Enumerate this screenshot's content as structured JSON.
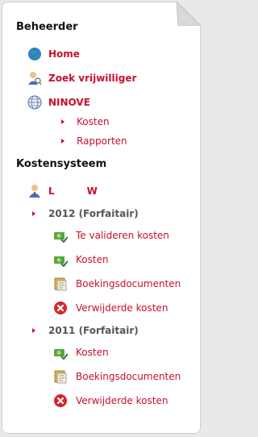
{
  "sections": {
    "beheerder": {
      "title": "Beheerder",
      "home": "Home",
      "zoek": "Zoek vrijwilliger",
      "ninove": "NINOVE",
      "kosten": "Kosten",
      "rapporten": "Rapporten"
    },
    "kostensysteem": {
      "title": "Kostensysteem",
      "user_initial": "L",
      "user_second": "W",
      "year_2012": "2012 (Forfaitair)",
      "items_2012": [
        "Te valideren kosten",
        "Kosten",
        "Boekingsdocumenten",
        "Verwijderde kosten"
      ],
      "year_2011": "2011 (Forfaitair)",
      "items_2011": [
        "Kosten",
        "Boekingsdocumenten",
        "Verwijderde kosten"
      ]
    }
  },
  "colors": {
    "link": "#c8102e",
    "heading": "#111111",
    "year": "#555555"
  },
  "icons": [
    "globe-icon",
    "user-search-icon",
    "web-globe-icon",
    "user-icon",
    "money-check-icon",
    "document-icon",
    "delete-icon"
  ]
}
